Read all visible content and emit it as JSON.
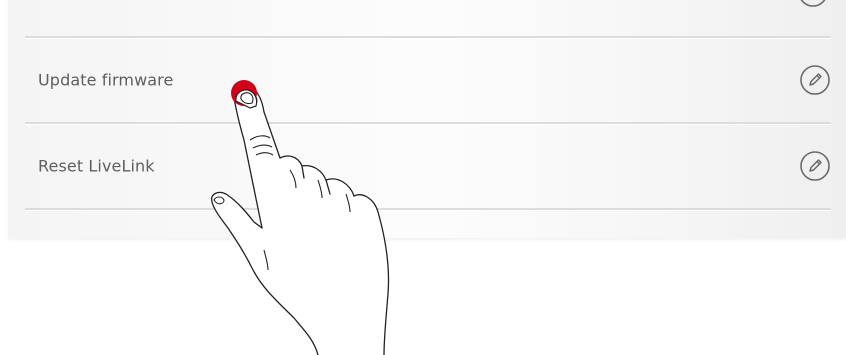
{
  "settings_list": {
    "items": [
      {
        "label": "Update firmware",
        "action_icon": "pencil-edit-icon"
      },
      {
        "label": "Reset LiveLink",
        "action_icon": "pencil-edit-icon"
      }
    ]
  },
  "overlay": {
    "gesture": "tap-hand-icon",
    "touch_point_color": "#d0001b"
  },
  "colors": {
    "panel_background": "#f8f8f8",
    "divider": "#dcdcdc",
    "label_text": "#5e5e5e",
    "icon_stroke": "#6a6a6a"
  }
}
